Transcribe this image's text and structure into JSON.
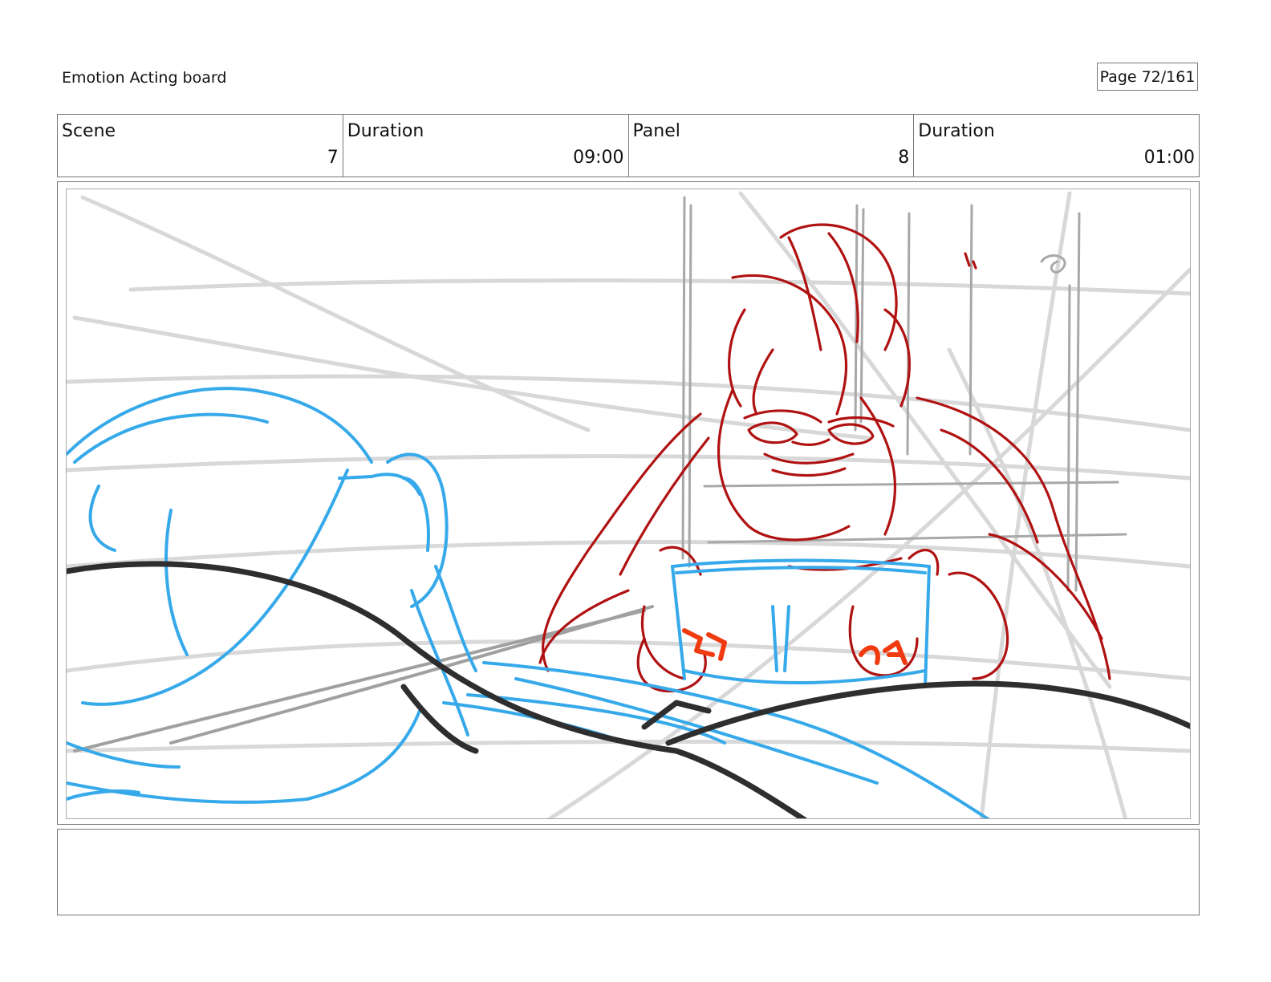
{
  "header": {
    "title": "Emotion Acting board",
    "page_label": "Page",
    "page_number": "72/161"
  },
  "info": {
    "scene_label": "Scene",
    "scene_value": "7",
    "scene_duration_label": "Duration",
    "scene_duration_value": "09:00",
    "panel_label": "Panel",
    "panel_value": "8",
    "panel_duration_label": "Duration",
    "panel_duration_value": "01:00"
  },
  "notes": {
    "text": ""
  },
  "colors": {
    "rough_red": "#b01212",
    "rough_blue": "#36a9ea",
    "ink_black": "#2e2e2e",
    "guide_gray": "#cfcfcf",
    "accent_orange": "#f03a10"
  }
}
